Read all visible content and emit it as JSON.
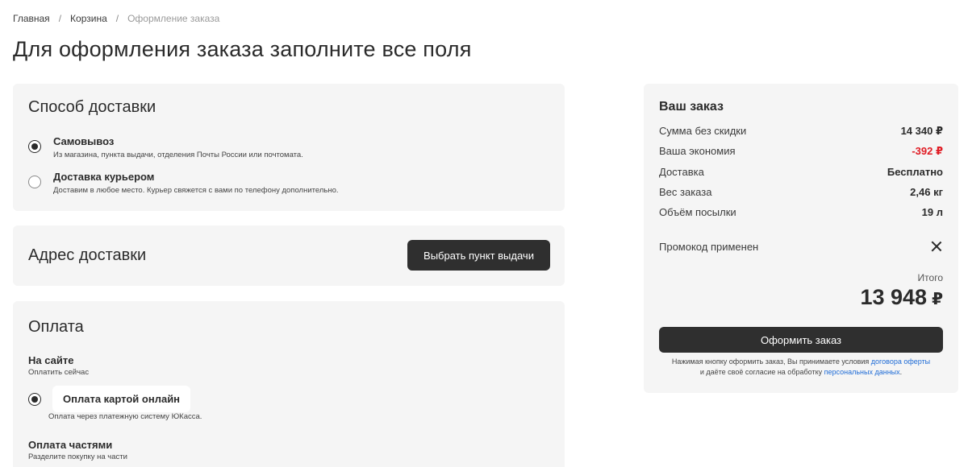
{
  "breadcrumb": {
    "home": "Главная",
    "cart": "Корзина",
    "current": "Оформление заказа",
    "separator": "/"
  },
  "page_title": "Для оформления заказа заполните все поля",
  "delivery": {
    "title": "Способ доставки",
    "options": [
      {
        "label": "Самовывоз",
        "desc": "Из магазина, пункта выдачи, отделения Почты России или почтомата.",
        "selected": true
      },
      {
        "label": "Доставка курьером",
        "desc": "Доставим в любое место. Курьер свяжется с вами по телефону дополнительно.",
        "selected": false
      }
    ]
  },
  "address": {
    "title": "Адрес доставки",
    "button": "Выбрать пункт выдачи"
  },
  "payment": {
    "title": "Оплата",
    "online_section": {
      "title": "На сайте",
      "sub": "Оплатить сейчас"
    },
    "card_option": {
      "label": "Оплата картой онлайн",
      "desc": "Оплата через платежную систему ЮКасса.",
      "selected": true
    },
    "installments": {
      "title": "Оплата частями",
      "sub": "Разделите покупку на части"
    }
  },
  "summary": {
    "title": "Ваш заказ",
    "rows": [
      {
        "label": "Сумма без скидки",
        "value": "14 340 ₽"
      },
      {
        "label": "Ваша экономия",
        "value": "-392 ₽"
      },
      {
        "label": "Доставка",
        "value": "Бесплатно"
      },
      {
        "label": "Вес заказа",
        "value": "2,46 кг"
      },
      {
        "label": "Объём посылки",
        "value": "19 л"
      }
    ],
    "promo": "Промокод применен",
    "total_label": "Итого",
    "total_value": "13 948",
    "currency": "₽",
    "checkout_button": "Оформить заказ",
    "terms_prefix": "Нажимая кнопку оформить заказ, Вы принимаете условия",
    "terms_link1": "договора оферты",
    "terms_middle": "и даёте своё согласие на обработку",
    "terms_link2": "персональных данных",
    "terms_suffix": "."
  },
  "colors": {
    "accent_dark": "#2f2f2f",
    "discount_red": "#e01c24",
    "link_blue": "#1e6bd6",
    "card_bg": "#f5f5f5"
  }
}
